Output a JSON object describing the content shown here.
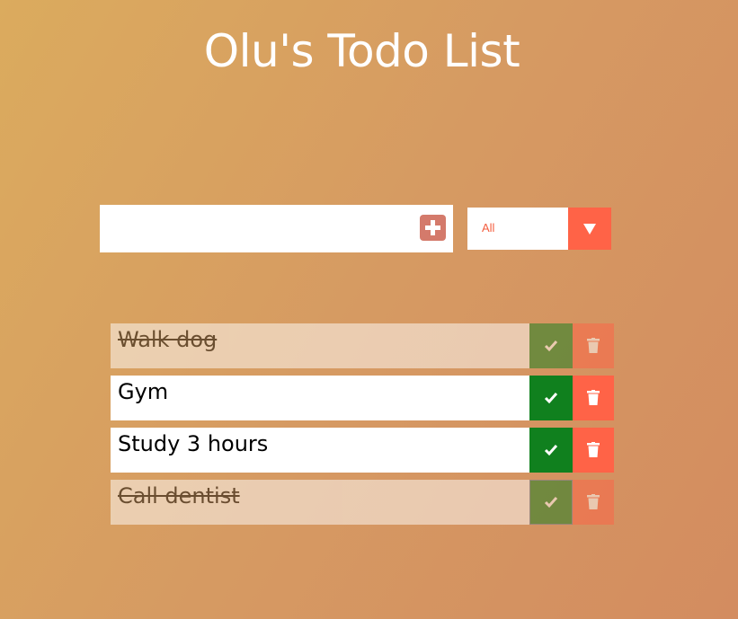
{
  "page": {
    "title": "Olu's Todo List"
  },
  "form": {
    "input_value": "",
    "input_placeholder": "",
    "add_icon": "plus-square-icon"
  },
  "filter": {
    "selected": "All",
    "arrow_icon": "caret-down-icon"
  },
  "todos": [
    {
      "text": "Walk dog",
      "completed": true
    },
    {
      "text": "Gym",
      "completed": false
    },
    {
      "text": "Study 3 hours",
      "completed": false
    },
    {
      "text": "Call dentist",
      "completed": true
    }
  ],
  "colors": {
    "gradient_start": "#dbab5e",
    "gradient_end": "#d38c60",
    "complete_button": "#10801e",
    "delete_button": "#ff6347",
    "add_button": "#d47a6b",
    "filter_text": "#f35d3e"
  }
}
